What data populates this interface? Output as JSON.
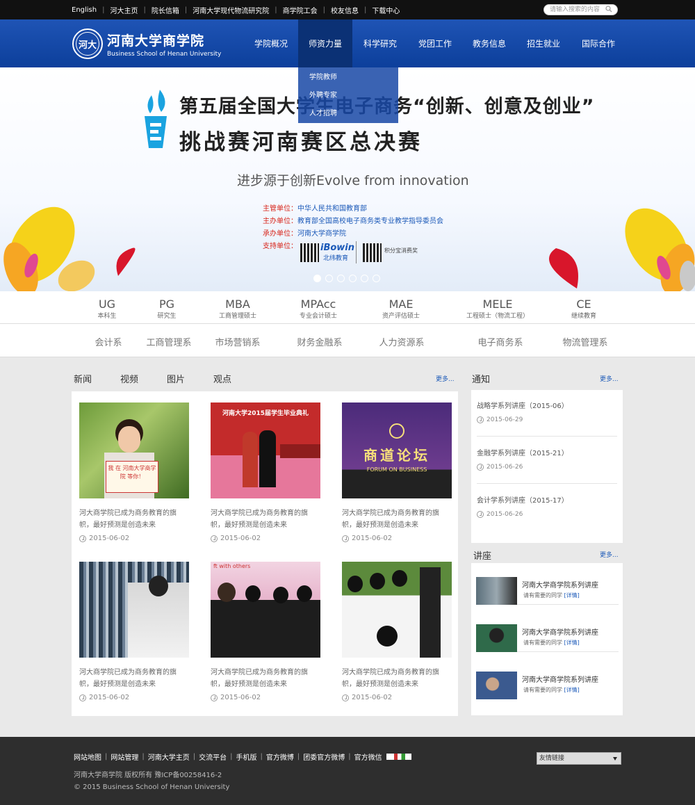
{
  "topbar": {
    "links": [
      "English",
      "河大主页",
      "院长信箱",
      "河南大学现代物流研究院",
      "商学院工会",
      "校友信息",
      "下载中心"
    ],
    "search_placeholder": "请输入搜索的内容"
  },
  "header": {
    "logo_text": "河大",
    "brand_cn": "河南大学商学院",
    "brand_en": "Business School of Henan University",
    "nav": [
      "学院概况",
      "师资力量",
      "科学研究",
      "党团工作",
      "教务信息",
      "招生就业",
      "国际合作"
    ],
    "active_nav": "师资力量",
    "dropdown": [
      "学院教师",
      "外聘专家",
      "人才招聘"
    ]
  },
  "banner": {
    "title_line1": "第五届全国大学生电子商务“创新、创意及创业”",
    "title_line2": "挑战赛河南赛区总决赛",
    "slogan": "进步源于创新Evolve from innovation",
    "orgs": [
      {
        "k": "主管单位：",
        "v": "中华人民共和国教育部"
      },
      {
        "k": "主办单位：",
        "v": "教育部全国高校电子商务类专业教学指导委员会"
      },
      {
        "k": "承办单位：",
        "v": "河南大学商学院"
      },
      {
        "k": "支持单位：",
        "v": ""
      }
    ],
    "sponsor1": "iBowin",
    "sponsor1_cn": "北纬教育",
    "sponsor2": "积分宝消费奖",
    "slides": 6,
    "active_slide": 1
  },
  "programs": [
    {
      "code": "UG",
      "name": "本科生"
    },
    {
      "code": "PG",
      "name": "研究生"
    },
    {
      "code": "MBA",
      "name": "工商管理硕士"
    },
    {
      "code": "MPAcc",
      "name": "专业会计硕士"
    },
    {
      "code": "MAE",
      "name": "资产评估硕士"
    },
    {
      "code": "MELE",
      "name": "工程硕士（物流工程）"
    },
    {
      "code": "CE",
      "name": "继续教育"
    }
  ],
  "departments": [
    "会计系",
    "工商管理系",
    "市场营销系",
    "财务金融系",
    "人力资源系",
    "电子商务系",
    "物流管理系"
  ],
  "news": {
    "tabs": [
      "新闻",
      "视频",
      "图片",
      "观点"
    ],
    "more": "更多...",
    "items": [
      {
        "title": "河大商学院已成为商务教育的旗帜，最好预测是创造未来",
        "date": "2015-06-02",
        "img_text": "我 在 河南大学商学院 等你！"
      },
      {
        "title": "河大商学院已成为商务教育的旗帜，最好预测是创造未来",
        "date": "2015-06-02",
        "img_text": "河南大学2015届学生毕业典礼"
      },
      {
        "title": "河大商学院已成为商务教育的旗帜，最好预测是创造未来",
        "date": "2015-06-02",
        "img_text": "商道论坛",
        "img_sub": "FORUM ON BUSINESS"
      },
      {
        "title": "河大商学院已成为商务教育的旗帜，最好预测是创造未来",
        "date": "2015-06-02",
        "img_text": ""
      },
      {
        "title": "河大商学院已成为商务教育的旗帜，最好预测是创造未来",
        "date": "2015-06-02",
        "img_text": "ft with others"
      },
      {
        "title": "河大商学院已成为商务教育的旗帜，最好预测是创造未来",
        "date": "2015-06-02",
        "img_text": ""
      }
    ]
  },
  "notice": {
    "title": "通知",
    "more": "更多...",
    "items": [
      {
        "title": "战略学系列讲座（2015-06）",
        "date": "2015-06-29"
      },
      {
        "title": "金融学系列讲座（2015-21）",
        "date": "2015-06-26"
      },
      {
        "title": "会计学系列讲座（2015-17）",
        "date": "2015-06-26"
      }
    ]
  },
  "lectures": {
    "title": "讲座",
    "more": "更多...",
    "items": [
      {
        "title": "河南大学商学院系列讲座",
        "sub": "请有需要的同学",
        "link": "[详情]"
      },
      {
        "title": "河南大学商学院系列讲座",
        "sub": "请有需要的同学",
        "link": "[详情]"
      },
      {
        "title": "河南大学商学院系列讲座",
        "sub": "请有需要的同学",
        "link": "[详情]"
      }
    ]
  },
  "footer": {
    "links": [
      "网站地图",
      "网站管理",
      "河南大学主页",
      "交流平台",
      "手机版",
      "官方微博",
      "团委官方微博",
      "官方微信"
    ],
    "copy1": "河南大学商学院  版权所有  豫ICP备00258416-2",
    "copy2": "© 2015 Business School of Henan University",
    "select_label": "友情链接"
  },
  "colors": {
    "brand_blue": "#1b4fb0",
    "dark_nav": "#0b3175",
    "footer_bg": "#2e2e2e",
    "accent_red": "#d8261b"
  }
}
